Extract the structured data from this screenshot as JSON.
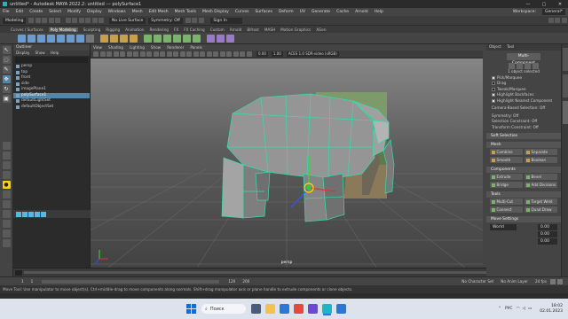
{
  "window": {
    "title": "untitled* - Autodesk MAYA 2022.2: untitled --- polySurface1",
    "min": "—",
    "max": "▢",
    "close": "✕"
  },
  "menus": [
    "File",
    "Edit",
    "Create",
    "Select",
    "Modify",
    "Display",
    "Windows",
    "Mesh",
    "Edit Mesh",
    "Mesh Tools",
    "Mesh Display",
    "Curves",
    "Surfaces",
    "Deform",
    "UV",
    "Generate",
    "Cache",
    "Arnold",
    "Help"
  ],
  "workspace": {
    "label": "Workspace:",
    "value": "General*"
  },
  "statusline": {
    "mode": "Modeling",
    "no_live": "No Live Surface",
    "symmetry": "Symmetry: Off",
    "sign_in": "Sign In"
  },
  "shelf_tabs": [
    "Curves / Surfaces",
    "Poly Modeling",
    "Sculpting",
    "Rigging",
    "Animation",
    "Rendering",
    "FX",
    "FX Caching",
    "Custom",
    "Arnold",
    "Bifrost",
    "MASH",
    "Motion Graphics",
    "XGen"
  ],
  "shelf_active": 1,
  "outliner": {
    "title": "Outliner",
    "menu": [
      "Display",
      "Show",
      "Help"
    ],
    "items": [
      {
        "label": "persp",
        "selected": false
      },
      {
        "label": "top",
        "selected": false
      },
      {
        "label": "front",
        "selected": false
      },
      {
        "label": "side",
        "selected": false
      },
      {
        "label": "imagePlane1",
        "selected": false
      },
      {
        "label": "polySurface1",
        "selected": true
      },
      {
        "label": "defaultLightSet",
        "selected": false
      },
      {
        "label": "defaultObjectSet",
        "selected": false
      }
    ]
  },
  "viewport": {
    "menu": [
      "View",
      "Shading",
      "Lighting",
      "Show",
      "Renderer",
      "Panels"
    ],
    "field1": "0.00",
    "field2": "1.00",
    "field3": "ACES 1.0 SDR-video (sRGB)",
    "camera_label": "persp"
  },
  "attr": {
    "tabs": [
      "Object",
      "Tool"
    ],
    "mode_button": "Multi-Component",
    "selected_count": "1 object selected",
    "checks": [
      {
        "label": "Pick/Marquee",
        "on": true
      },
      {
        "label": "Drag",
        "on": false
      },
      {
        "label": "Tweak/Marquee",
        "on": false
      },
      {
        "label": "Highlight Backfaces",
        "on": true
      },
      {
        "label": "Highlight Nearest Component",
        "on": true
      }
    ],
    "camera_based": "Camera-Based Selection: Off",
    "symmetry": "Symmetry: Off",
    "selection_constraint": "Selection Constraint: Off",
    "transform_constraint": "Transform Constraint: Off",
    "soft_selection": "Soft Selection",
    "sections": {
      "mesh": "Mesh",
      "components": "Components",
      "tools": "Tools",
      "move_settings": "Move Settings"
    },
    "mesh_buttons": [
      [
        "Combine",
        "Separate"
      ],
      [
        "Smooth",
        "Boolean"
      ]
    ],
    "component_buttons": [
      [
        "Extrude",
        "Bevel"
      ],
      [
        "Bridge",
        "Add Divisions"
      ]
    ],
    "tool_buttons": [
      [
        "Multi-Cut",
        "Target Weld"
      ],
      [
        "Connect",
        "Quad Draw"
      ]
    ],
    "world_label": "World",
    "world_values": [
      "0.00",
      "0.00",
      "0.00"
    ]
  },
  "range": {
    "start": "1",
    "end": "120",
    "start2": "1",
    "end2": "200",
    "no_char": "No Character Set",
    "no_anim": "No Anim Layer",
    "fps": "24 fps"
  },
  "help": "Move Tool: Use manipulator to move object(s). Ctrl+middle-drag to move components along normals. Shift+drag manipulator axis or plane handle to extrude components or clone objects.",
  "taskbar": {
    "search": "Поиск",
    "lang": "РУС",
    "time": "18:02",
    "date": "02.01.2023"
  },
  "colors": {
    "accent": "#5285a6",
    "wire": "#33ddaa",
    "mesh": "#8e8e8e"
  }
}
